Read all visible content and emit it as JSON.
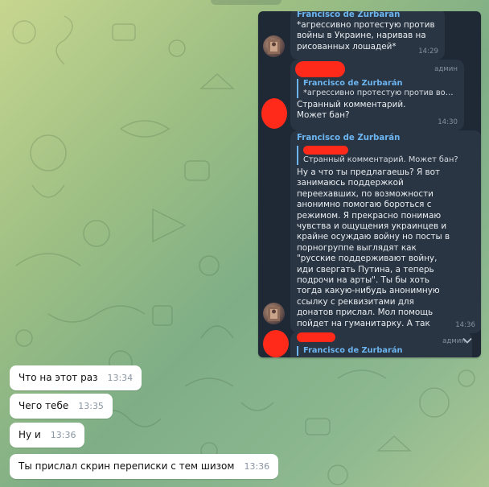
{
  "screenshot": {
    "msg1": {
      "sender": "Francisco de Zurbarán",
      "text": "*агрессивно протестую против войны в Украине, наривав на рисованных лошадей*",
      "time": "14:29"
    },
    "msg2": {
      "badge": "админ",
      "reply_name": "Francisco de Zurbarán",
      "reply_text": "*агрессивно протестую против войн...",
      "text": "Странный комментарий. Может бан?",
      "time": "14:30"
    },
    "msg3": {
      "sender": "Francisco de Zurbarán",
      "reply_text": "Странный комментарий. Может бан?",
      "text": "Ну а что ты предлагаешь? Я вот занимаюсь поддержкой переехавших, по возможности анонимно помогаю бороться с режимом. Я прекрасно понимаю чувства и ощущения украинцев и крайне осуждаю войну но посты в порногруппе выглядят как \"русские поддерживают войну, иди свергать Путина, а теперь подрочи на арты\". Ты бы хоть тогда какую-нибудь анонимную ссылку с реквизитами для донатов прислал. Мол помощь пойдет на гуманитарку. А так реально слова ради слов",
      "time": "14:36"
    },
    "msg4": {
      "badge": "админ",
      "reply_name": "Francisco de Zurbarán"
    }
  },
  "messages": [
    {
      "text": "Что на этот раз",
      "time": "13:34"
    },
    {
      "text": "Чего тебе",
      "time": "13:35"
    },
    {
      "text": "Ну и",
      "time": "13:36"
    },
    {
      "text": "Ты прислал скрин переписки с тем шизом",
      "time": "13:36"
    }
  ],
  "icons": {
    "scroll_down": "chevron-down-icon"
  },
  "colors": {
    "accent_name": "#6cb5f0",
    "redaction": "#ff2a1a",
    "dark_bubble": "#2a3543"
  }
}
